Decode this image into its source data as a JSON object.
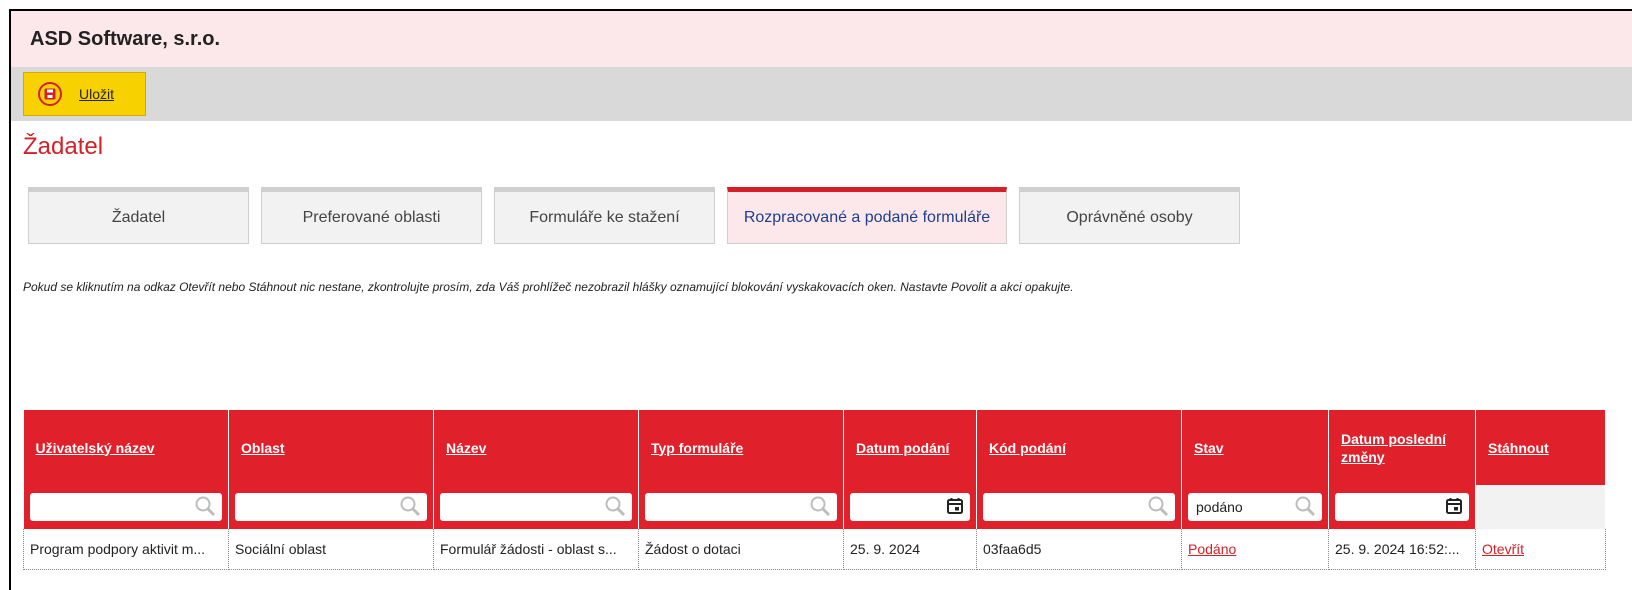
{
  "company": "ASD Software, s.r.o.",
  "toolbar": {
    "save_label": "Uložit"
  },
  "page_title": "Žadatel",
  "tabs": [
    {
      "label": "Žadatel",
      "active": false
    },
    {
      "label": "Preferované oblasti",
      "active": false
    },
    {
      "label": "Formuláře ke stažení",
      "active": false
    },
    {
      "label": "Rozpracované a podané formuláře",
      "active": true
    },
    {
      "label": "Oprávněné osoby",
      "active": false
    }
  ],
  "notice": "Pokud se kliknutím na odkaz Otevřít nebo Stáhnout nic nestane, zkontrolujte prosím, zda Váš prohlížeč nezobrazil hlášky oznamující blokování vyskakovacích oken. Nastavte Povolit a akci opakujte.",
  "table": {
    "columns": [
      {
        "label": "Uživatelský název",
        "filter": "search",
        "filter_value": ""
      },
      {
        "label": "Oblast",
        "filter": "search",
        "filter_value": ""
      },
      {
        "label": "Název",
        "filter": "search",
        "filter_value": ""
      },
      {
        "label": "Typ formuláře",
        "filter": "search",
        "filter_value": ""
      },
      {
        "label": "Datum podání",
        "filter": "date",
        "filter_value": ""
      },
      {
        "label": "Kód podání",
        "filter": "search",
        "filter_value": ""
      },
      {
        "label": "Stav",
        "filter": "search",
        "filter_value": "podáno"
      },
      {
        "label": "Datum poslední změny",
        "filter": "date",
        "filter_value": ""
      },
      {
        "label": "Stáhnout",
        "filter": "none",
        "filter_value": ""
      }
    ],
    "rows": [
      {
        "uzivatelsky_nazev": "Program podpory aktivit m...",
        "oblast": "Sociální oblast",
        "nazev": "Formulář žádosti - oblast s...",
        "typ_formulare": "Žádost o dotaci",
        "datum_podani": "25. 9. 2024",
        "kod_podani": "03faa6d5",
        "stav": "Podáno",
        "datum_posledni_zmeny": "25. 9. 2024 16:52:...",
        "stahnout": "Otevřít"
      }
    ]
  },
  "colors": {
    "accent_red": "#e0202a",
    "save_yellow": "#f8d100",
    "header_pink": "#fce8ea"
  }
}
